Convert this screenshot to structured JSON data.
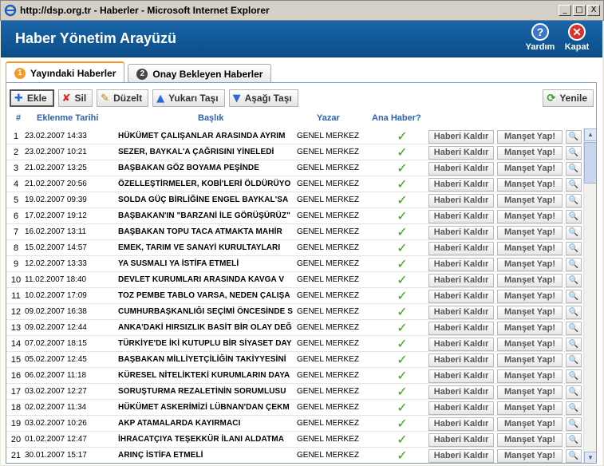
{
  "window": {
    "title": "http://dsp.org.tr - Haberler - Microsoft Internet Explorer",
    "buttons": [
      "_",
      "□",
      "X"
    ]
  },
  "header": {
    "title": "Haber Yönetim Arayüzü",
    "help_label": "Yardım",
    "close_label": "Kapat",
    "help_icon": "question-icon",
    "close_icon": "close-icon"
  },
  "tabs": [
    {
      "num": "1",
      "label": "Yayındaki Haberler",
      "active": true
    },
    {
      "num": "2",
      "label": "Onay Bekleyen Haberler",
      "active": false
    }
  ],
  "toolbar": {
    "add": "Ekle",
    "delete": "Sil",
    "edit": "Düzelt",
    "move_up": "Yukarı Taşı",
    "move_down": "Aşağı Taşı",
    "refresh": "Yenile"
  },
  "columns": {
    "num": "#",
    "date": "Eklenme Tarihi",
    "title": "Başlık",
    "author": "Yazar",
    "main": "Ana Haber?"
  },
  "row_buttons": {
    "remove": "Haberi Kaldır",
    "headline": "Manşet Yap!"
  },
  "rows": [
    {
      "n": "1",
      "date": "23.02.2007 14:33",
      "title": "HÜKÜMET ÇALIŞANLAR ARASINDA AYRIM",
      "author": "GENEL MERKEZ"
    },
    {
      "n": "2",
      "date": "23.02.2007 10:21",
      "title": "SEZER, BAYKAL'A ÇAĞRISINI YİNELEDİ",
      "author": "GENEL MERKEZ"
    },
    {
      "n": "3",
      "date": "21.02.2007 13:25",
      "title": "BAŞBAKAN GÖZ BOYAMA PEŞİNDE",
      "author": "GENEL MERKEZ"
    },
    {
      "n": "4",
      "date": "21.02.2007 20:56",
      "title": "ÖZELLEŞTİRMELER, KOBİ'LERİ ÖLDÜRÜYO",
      "author": "GENEL MERKEZ"
    },
    {
      "n": "5",
      "date": "19.02.2007 09:39",
      "title": "SOLDA GÜÇ BİRLİĞİNE ENGEL BAYKAL'SA",
      "author": "GENEL MERKEZ"
    },
    {
      "n": "6",
      "date": "17.02.2007 19:12",
      "title": "BAŞBAKAN'IN \"BARZANİ İLE GÖRÜŞÜRÜZ\"",
      "author": "GENEL MERKEZ"
    },
    {
      "n": "7",
      "date": "16.02.2007 13:11",
      "title": "BAŞBAKAN TOPU TACA ATMAKTA MAHİR",
      "author": "GENEL MERKEZ"
    },
    {
      "n": "8",
      "date": "15.02.2007 14:57",
      "title": "EMEK, TARIM VE SANAYİ KURULTAYLARI",
      "author": "GENEL MERKEZ"
    },
    {
      "n": "9",
      "date": "12.02.2007 13:33",
      "title": "YA SUSMALI YA İSTİFA ETMELİ",
      "author": "GENEL MERKEZ"
    },
    {
      "n": "10",
      "date": "11.02.2007 18:40",
      "title": "DEVLET KURUMLARI ARASINDA KAVGA V",
      "author": "GENEL MERKEZ"
    },
    {
      "n": "11",
      "date": "10.02.2007 17:09",
      "title": "TOZ PEMBE TABLO VARSA, NEDEN ÇALIŞA",
      "author": "GENEL MERKEZ"
    },
    {
      "n": "12",
      "date": "09.02.2007 16:38",
      "title": "CUMHURBAŞKANLIĞI SEÇİMİ ÖNCESİNDE S",
      "author": "GENEL MERKEZ"
    },
    {
      "n": "13",
      "date": "09.02.2007 12:44",
      "title": "ANKA'DAKİ HIRSIZLIK BASİT BİR OLAY DEĞ",
      "author": "GENEL MERKEZ"
    },
    {
      "n": "14",
      "date": "07.02.2007 18:15",
      "title": "TÜRKİYE'DE İKİ KUTUPLU BİR SİYASET DAY",
      "author": "GENEL MERKEZ"
    },
    {
      "n": "15",
      "date": "05.02.2007 12:45",
      "title": "BAŞBAKAN MİLLİYETÇİLİĞİN TAKİYYESİNİ",
      "author": "GENEL MERKEZ"
    },
    {
      "n": "16",
      "date": "06.02.2007 11:18",
      "title": "KÜRESEL NİTELİKTEKİ KURUMLARIN DAYA",
      "author": "GENEL MERKEZ"
    },
    {
      "n": "17",
      "date": "03.02.2007 12:27",
      "title": "SORUŞTURMA REZALETİNİN SORUMLUSU",
      "author": "GENEL MERKEZ"
    },
    {
      "n": "18",
      "date": "02.02.2007 11:34",
      "title": "HÜKÜMET ASKERİMİZİ LÜBNAN'DAN ÇEKM",
      "author": "GENEL MERKEZ"
    },
    {
      "n": "19",
      "date": "03.02.2007 10:26",
      "title": "AKP ATAMALARDA KAYIRMACI",
      "author": "GENEL MERKEZ"
    },
    {
      "n": "20",
      "date": "01.02.2007 12:47",
      "title": "İHRACATÇIYA TEŞEKKÜR İLANI ALDATMA",
      "author": "GENEL MERKEZ"
    },
    {
      "n": "21",
      "date": "30.01.2007 15:17",
      "title": "ARINÇ İSTİFA ETMELİ",
      "author": "GENEL MERKEZ"
    }
  ]
}
